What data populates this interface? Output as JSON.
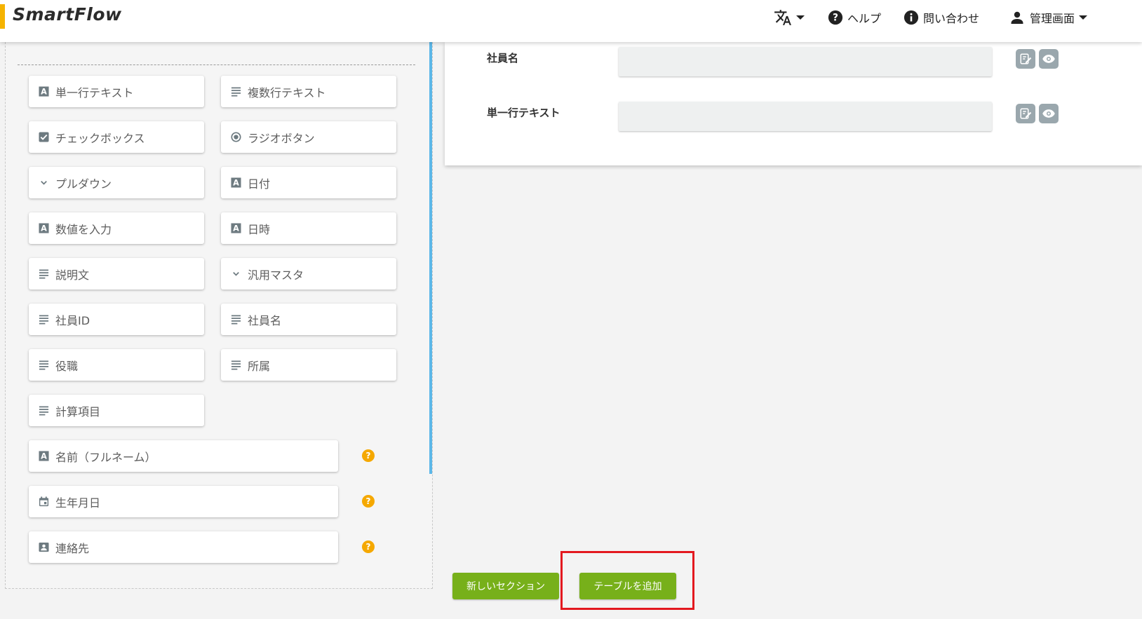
{
  "header": {
    "logo": "SmartFlow",
    "help_label": "ヘルプ",
    "contact_label": "問い合わせ",
    "admin_label": "管理画面"
  },
  "palette": {
    "items": [
      {
        "label": "単一行テキスト",
        "icon": "text-a-icon"
      },
      {
        "label": "複数行テキスト",
        "icon": "lines-icon"
      },
      {
        "label": "チェックボックス",
        "icon": "checkbox-icon"
      },
      {
        "label": "ラジオボタン",
        "icon": "radio-icon"
      },
      {
        "label": "プルダウン",
        "icon": "chevron-down-icon"
      },
      {
        "label": "日付",
        "icon": "text-a-icon"
      },
      {
        "label": "数値を入力",
        "icon": "text-a-icon"
      },
      {
        "label": "日時",
        "icon": "text-a-icon"
      },
      {
        "label": "説明文",
        "icon": "lines-icon"
      },
      {
        "label": "汎用マスタ",
        "icon": "chevron-down-icon"
      },
      {
        "label": "社員ID",
        "icon": "lines-icon"
      },
      {
        "label": "社員名",
        "icon": "lines-icon"
      },
      {
        "label": "役職",
        "icon": "lines-icon"
      },
      {
        "label": "所属",
        "icon": "lines-icon"
      },
      {
        "label": "計算項目",
        "icon": "lines-icon"
      }
    ],
    "wide_items": [
      {
        "label": "名前（フルネーム）",
        "icon": "text-a-icon",
        "help": "?"
      },
      {
        "label": "生年月日",
        "icon": "calendar-icon",
        "help": "?"
      },
      {
        "label": "連絡先",
        "icon": "contact-card-icon",
        "help": "?"
      }
    ]
  },
  "form": {
    "rows": [
      {
        "label": "社員名",
        "value": ""
      },
      {
        "label": "単一行テキスト",
        "value": ""
      }
    ]
  },
  "actions": {
    "new_section_label": "新しいセクション",
    "add_table_label": "テーブルを追加"
  },
  "colors": {
    "accent_green": "#77b01a",
    "logo_yellow": "#f5b300",
    "help_orange": "#f5a800",
    "highlight_red": "#e3191f",
    "drop_zone_blue": "#5cb7e8"
  }
}
